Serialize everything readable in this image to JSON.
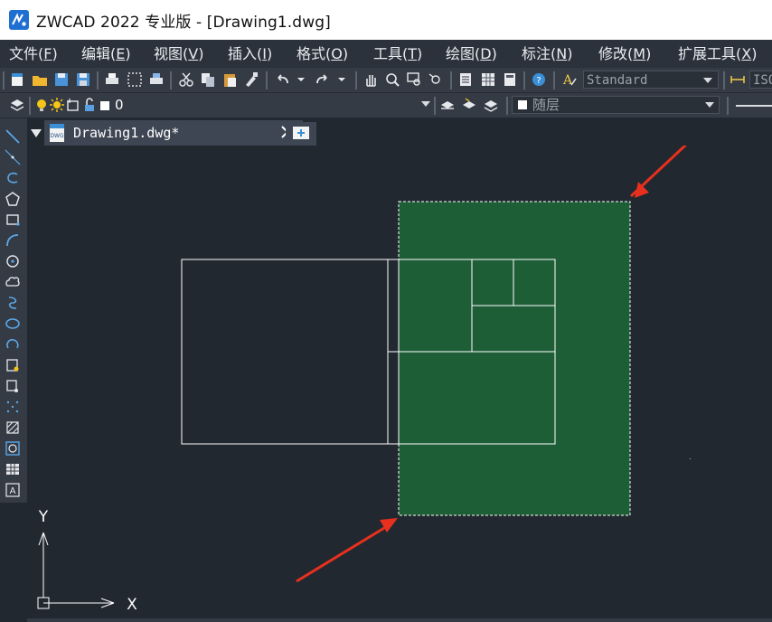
{
  "window": {
    "title": "ZWCAD 2022 专业版 - [Drawing1.dwg]"
  },
  "menu": {
    "items": [
      {
        "label": "文件(",
        "key": "F",
        "tail": ")"
      },
      {
        "label": "编辑(",
        "key": "E",
        "tail": ")"
      },
      {
        "label": "视图(",
        "key": "V",
        "tail": ")"
      },
      {
        "label": "插入(",
        "key": "I",
        "tail": ")"
      },
      {
        "label": "格式(",
        "key": "O",
        "tail": ")"
      },
      {
        "label": "工具(",
        "key": "T",
        "tail": ")"
      },
      {
        "label": "绘图(",
        "key": "D",
        "tail": ")"
      },
      {
        "label": "标注(",
        "key": "N",
        "tail": ")"
      },
      {
        "label": "修改(",
        "key": "M",
        "tail": ")"
      },
      {
        "label": "扩展工具(",
        "key": "X",
        "tail": ")"
      }
    ]
  },
  "toolbar": {
    "text_style": "Standard",
    "dim_style": "ISO",
    "layer_name": "0",
    "color_value": "随层"
  },
  "tabs": [
    {
      "label": "Drawing1.dwg*"
    }
  ],
  "canvas": {
    "ucs_x_label": "X",
    "ucs_y_label": "Y"
  },
  "colors": {
    "canvas_bg": "#212830",
    "selection_fill": "#1d5e37",
    "annotation_arrow": "#e8301e"
  }
}
